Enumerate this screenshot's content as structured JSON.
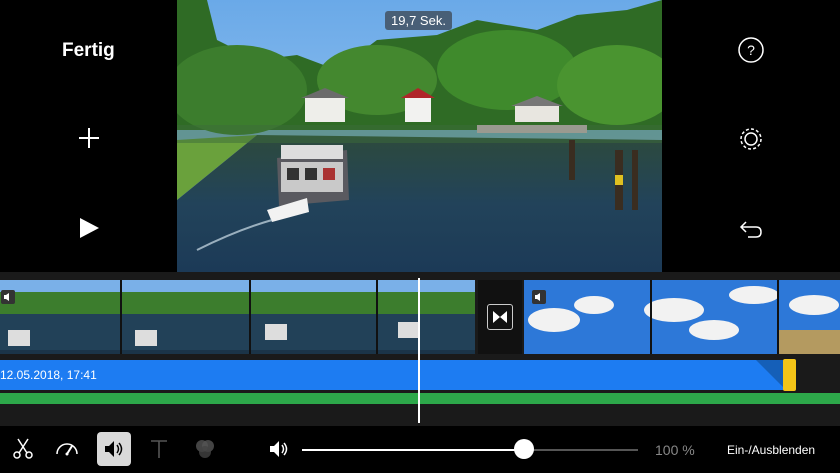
{
  "header": {
    "done_label": "Fertig",
    "duration": "19,7 Sek."
  },
  "timeline": {
    "audio_label": "12.05.2018, 17:41"
  },
  "toolbar": {
    "volume_percent_label": "100 %",
    "volume_level": 0.66,
    "fade_label": "Ein-/Ausblenden"
  },
  "colors": {
    "audio_track": "#1d7cf2",
    "audio_handle": "#f5c518",
    "green_track": "#2da84a"
  }
}
